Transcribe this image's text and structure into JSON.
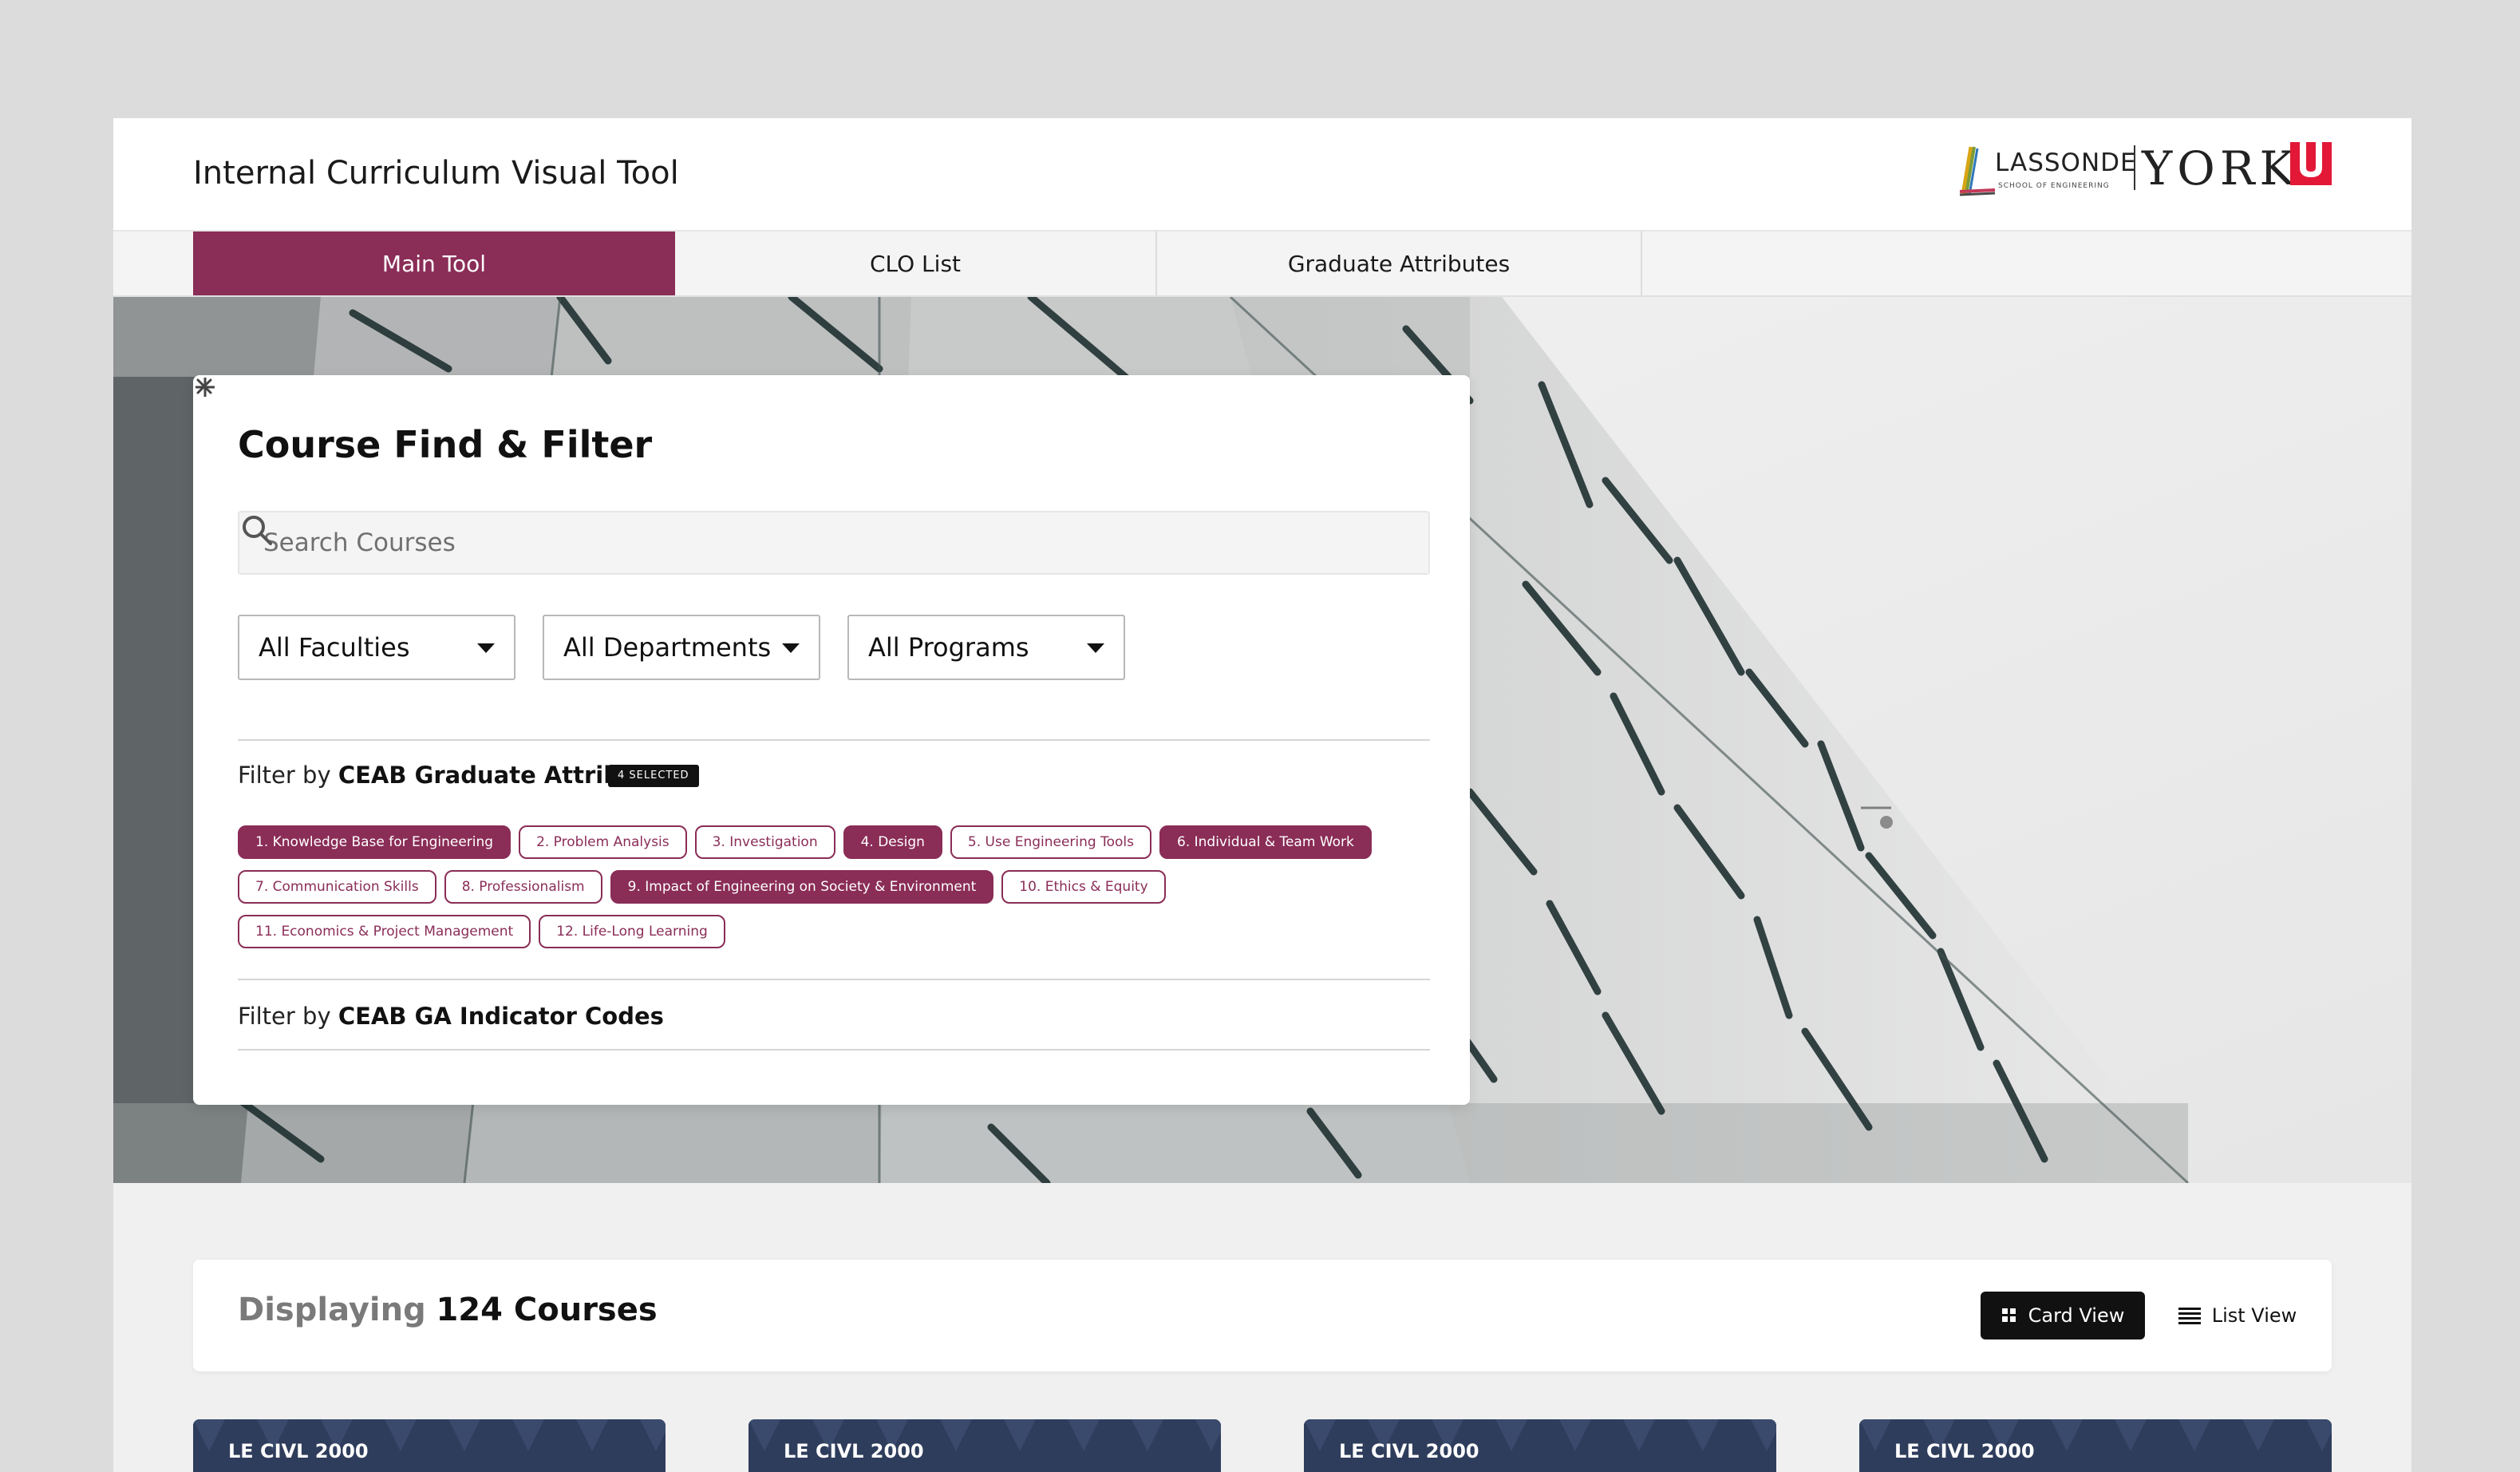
{
  "header": {
    "title": "Internal Curriculum Visual Tool",
    "logo": {
      "lassonde": "LASSONDE",
      "lassonde_sub": "SCHOOL OF ENGINEERING",
      "york": "YORK"
    }
  },
  "tabs": [
    {
      "label": "Main Tool",
      "active": true
    },
    {
      "label": "CLO List",
      "active": false
    },
    {
      "label": "Graduate Attributes",
      "active": false
    }
  ],
  "filter_card": {
    "title": "Course Find & Filter",
    "search_placeholder": "Search Courses",
    "selects": [
      "All Faculties",
      "All Departments",
      "All Programs"
    ],
    "ga_section": {
      "prefix": "Filter by ",
      "label": "CEAB Graduate Attributes",
      "badge": "4 SELECTED",
      "chips": [
        {
          "label": "1. Knowledge Base for Engineering",
          "selected": true
        },
        {
          "label": "2. Problem Analysis",
          "selected": false
        },
        {
          "label": "3. Investigation",
          "selected": false
        },
        {
          "label": "4. Design",
          "selected": true
        },
        {
          "label": "5. Use Engineering Tools",
          "selected": false
        },
        {
          "label": "6. Individual & Team Work",
          "selected": true
        },
        {
          "label": "7. Communication Skills",
          "selected": false
        },
        {
          "label": "8. Professionalism",
          "selected": false
        },
        {
          "label": "9. Impact of Engineering on Society & Environment",
          "selected": true
        },
        {
          "label": "10. Ethics & Equity",
          "selected": false
        },
        {
          "label": "11. Economics & Project Management",
          "selected": false
        },
        {
          "label": "12. Life-Long Learning",
          "selected": false
        }
      ]
    },
    "indicator_section": {
      "prefix": "Filter by ",
      "label": "CEAB GA Indicator Codes"
    }
  },
  "results": {
    "displaying": "Displaying",
    "count_text": "124 Courses",
    "card_view": "Card View",
    "list_view": "List View"
  },
  "courses": [
    "LE CIVL 2000",
    "LE CIVL 2000",
    "LE CIVL 2000",
    "LE CIVL 2000"
  ],
  "colors": {
    "accent": "#8a2d57",
    "york_red": "#e31837",
    "course_header": "#2f3d5c"
  }
}
